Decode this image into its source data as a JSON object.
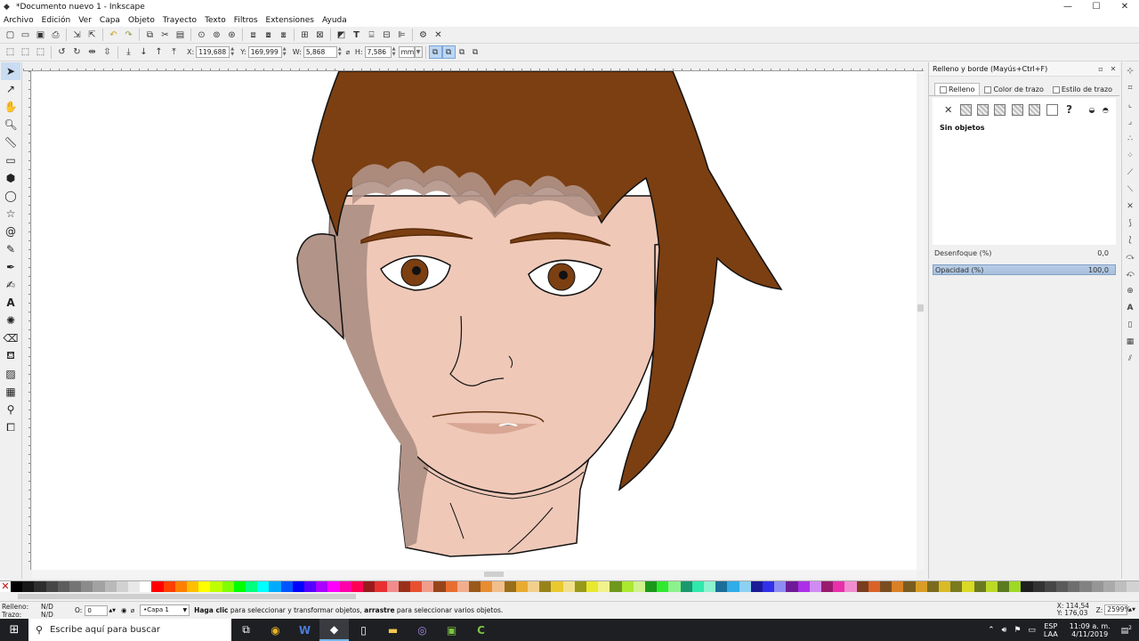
{
  "window": {
    "title": "*Documento nuevo 1 - Inkscape",
    "controls": [
      "—",
      "☐",
      "✕"
    ]
  },
  "menu": [
    "Archivo",
    "Edición",
    "Ver",
    "Capa",
    "Objeto",
    "Trayecto",
    "Texto",
    "Filtros",
    "Extensiones",
    "Ayuda"
  ],
  "controls": {
    "x_label": "X:",
    "x": "119,688",
    "y_label": "Y:",
    "y": "169,999",
    "w_label": "W:",
    "w": "5,868",
    "h_label": "H:",
    "h": "7,586",
    "unit": "mm"
  },
  "dock": {
    "title": "Relleno y borde (Mayús+Ctrl+F)",
    "tabs": [
      "Relleno",
      "Color de trazo",
      "Estilo de trazo"
    ],
    "no_objects": "Sin objetos",
    "blur_label": "Desenfoque (%)",
    "blur_value": "0,0",
    "opacity_label": "Opacidad (%)",
    "opacity_value": "100,0"
  },
  "status": {
    "fill_label": "Relleno:",
    "fill_value": "N/D",
    "stroke_label": "Trazo:",
    "stroke_value": "N/D",
    "opacity_label": "O:",
    "opacity_value": "0",
    "layer": "•Capa 1",
    "msg_bold1": "Haga clic",
    "msg_text1": " para seleccionar y transformar objetos, ",
    "msg_bold2": "arrastre",
    "msg_text2": " para seleccionar varios objetos.",
    "x_label": "X:",
    "x": "114,54",
    "y_label": "Y:",
    "y": "176,03",
    "zoom_label": "Z:",
    "zoom": "2599%"
  },
  "taskbar": {
    "search_placeholder": "Escribe aquí para buscar",
    "lang_top": "ESP",
    "lang_bottom": "LAA",
    "time": "11:09 a. m.",
    "date": "4/11/2019",
    "notif_count": "2"
  },
  "colors": {
    "hair": "#7b3f12",
    "skin": "#efc8b8",
    "shadow": "#b39488",
    "selection": "#bcd6f3"
  }
}
